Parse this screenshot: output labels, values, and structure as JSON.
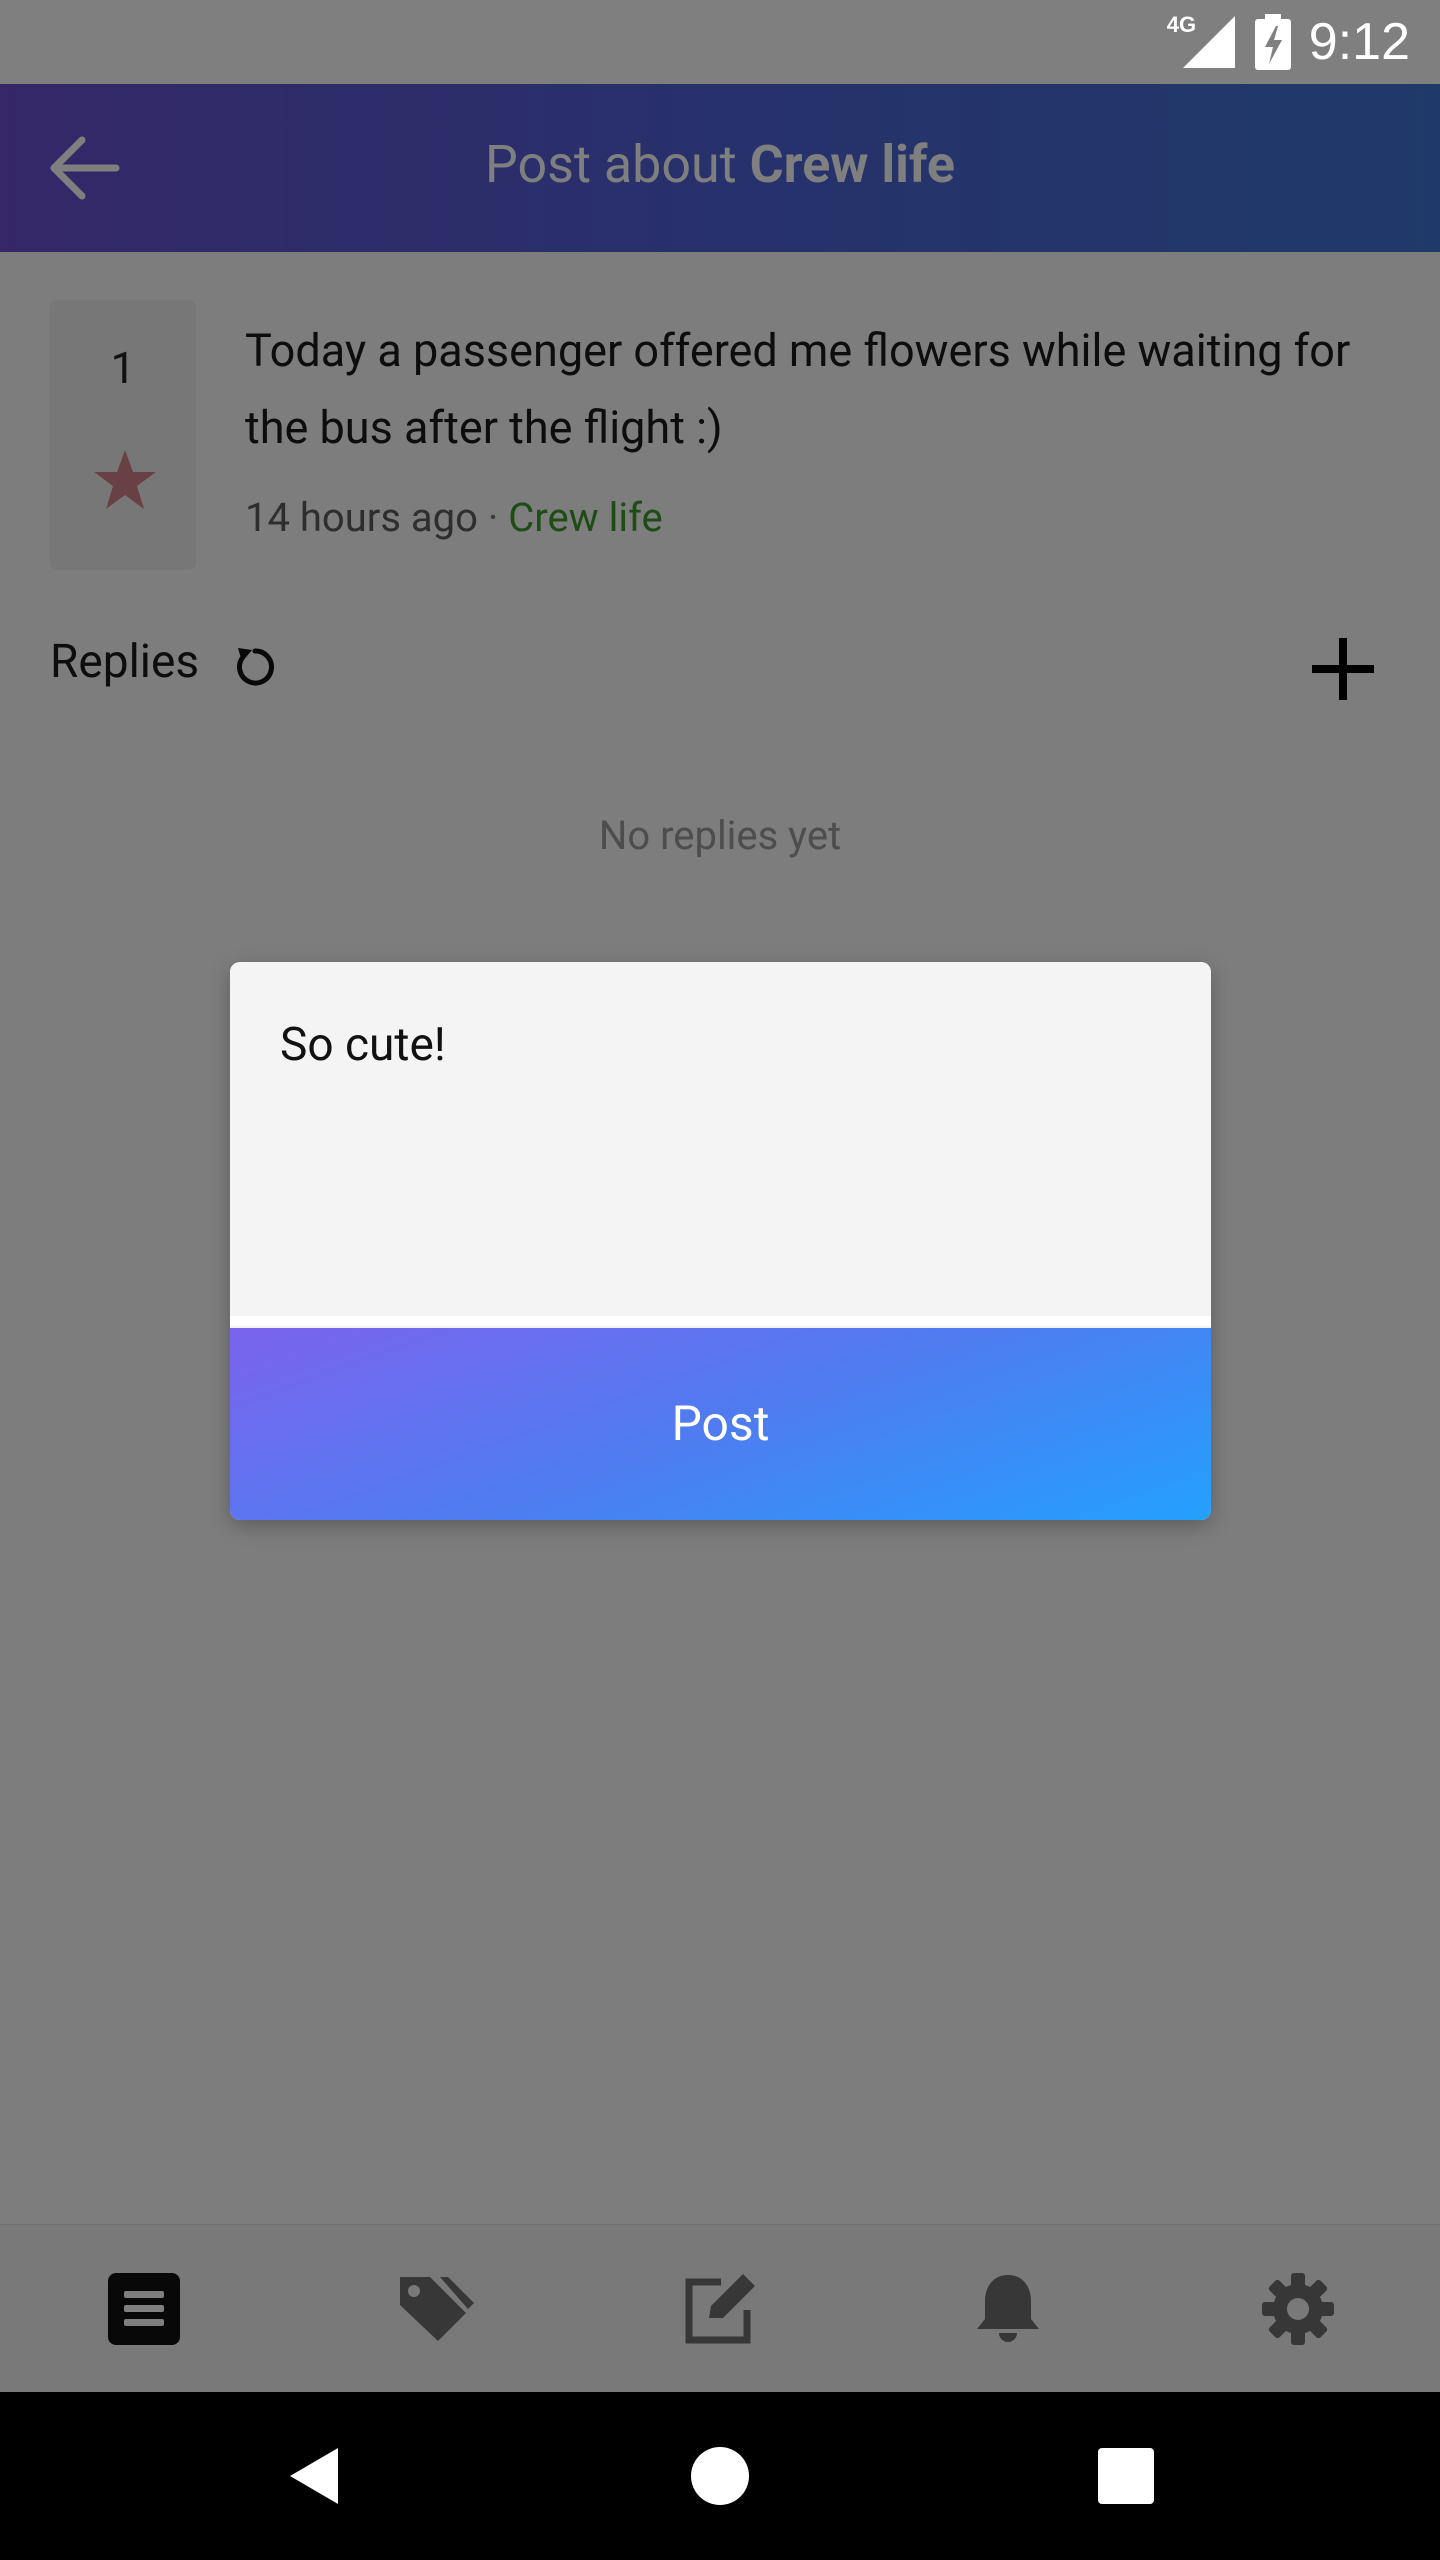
{
  "status_bar": {
    "network": "4G",
    "time": "9:12",
    "icons": [
      "signal-icon",
      "battery-charging-icon"
    ]
  },
  "header": {
    "title_prefix": "Post about ",
    "title_topic": "Crew life",
    "back_icon": "arrow-back-icon",
    "background": [
      "#6a4fd0",
      "#3f74d4"
    ]
  },
  "post": {
    "votes": "1",
    "vote_icon": "star-icon",
    "text": "Today a passenger offered me flowers while waiting for the bus after the flight :)",
    "time_ago": "14 hours ago",
    "separator": "·",
    "category": "Crew life",
    "category_color": "#3a9b2a"
  },
  "replies": {
    "label": "Replies",
    "empty_text": "No replies yet",
    "refresh_icon": "refresh-icon",
    "add_icon": "plus-icon"
  },
  "dialog": {
    "input_value": "So cute!",
    "post_label": "Post"
  },
  "bottom_nav": {
    "items": [
      {
        "name": "feed",
        "icon": "list-icon",
        "active": true
      },
      {
        "name": "tags",
        "icon": "tags-icon",
        "active": false
      },
      {
        "name": "compose",
        "icon": "edit-icon",
        "active": false
      },
      {
        "name": "notifications",
        "icon": "bell-icon",
        "active": false
      },
      {
        "name": "settings",
        "icon": "gear-icon",
        "active": false
      }
    ]
  },
  "system_nav": {
    "buttons": [
      "back-triangle-icon",
      "home-circle-icon",
      "recents-square-icon"
    ]
  }
}
